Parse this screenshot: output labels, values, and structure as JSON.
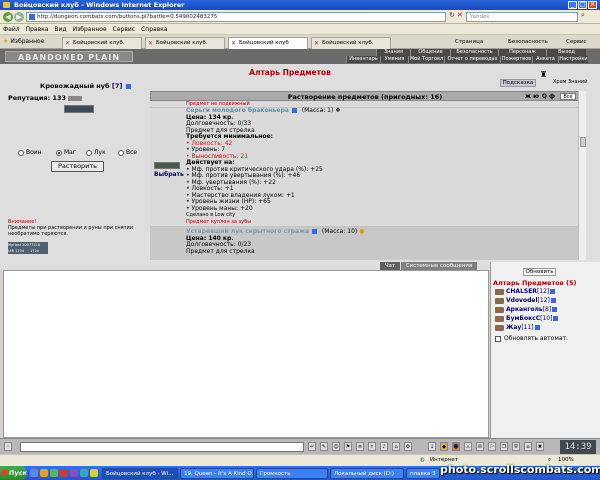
{
  "window": {
    "title": "Бойцовский клуб - Windows Internet Explorer",
    "url": "http://dungeon.combats.com/buttons.pl?battle=0.549002483275",
    "search_placeholder": "Yandex"
  },
  "menu": [
    "Файл",
    "Правка",
    "Вид",
    "Избранное",
    "Сервис",
    "Справка"
  ],
  "tabs_bar": {
    "favorites": "Избранное",
    "tabs": [
      "Бойцовский клуб.",
      "Бойцовский клуб.",
      "Бойцовский клуб",
      "Бойцовский клуб."
    ],
    "tools": [
      "Страница",
      "Безопасность",
      "Сервис"
    ]
  },
  "game": {
    "logo": "ABANDONED PLAIN",
    "nav_top": [
      "Знания",
      "Общение",
      "Безопасность",
      "Персонаж",
      "Выход"
    ],
    "nav_bottom": [
      "Инвентарь",
      "Умения",
      "Мой Торговл",
      "Отчет о переводах",
      "Пожертвов",
      "Анкета",
      "Настройки"
    ],
    "guard_label": "Храм Знаний",
    "page_title": "Алтарь Предметов",
    "hint_button": "Подсказка",
    "user": {
      "name": "Кровожадный нуб",
      "level": "[7]"
    },
    "reputation": "Репутация: 133",
    "classes": [
      {
        "label": "Воин",
        "selected": false
      },
      {
        "label": "Маг",
        "selected": true
      },
      {
        "label": "Лук",
        "selected": false
      },
      {
        "label": "Все",
        "selected": false
      }
    ],
    "dissolve_button": "Растворить",
    "warning_title": "Внимание!",
    "warning_text": "Предметы при растворении и руны при снятии необратимо теряются.",
    "counters": [
      "MyHost 20077118",
      "UIR 1234",
      "1724"
    ],
    "table_header": "Растворение предметов (пригодных: 16)",
    "table_controls": [
      "ж",
      "ю",
      "Q",
      "ф"
    ],
    "filter_select": "Все",
    "choose_label": "Выбрать",
    "items": [
      {
        "note_above": "Предмет не подвижный",
        "name": "Серьги молодого браконьера",
        "mass": "(Масса: 1)",
        "price": "Цена: 134 кр.",
        "durability": "Долговечность: 0/33",
        "item_for": "Предмет для стрелка",
        "req_title": "Требуется минимальное:",
        "reqs": [
          {
            "text": "• Ловкость: 42",
            "color": "#d01010"
          },
          {
            "text": "• Уровень: 7",
            "color": "#000000"
          },
          {
            "text": "• Выносливость: 21",
            "color": "#d01010"
          }
        ],
        "effects_title": "Действует на:",
        "effects": [
          "• Мф. против критического удара (%): +25",
          "• Мф. против увертывания (%): +46",
          "• Мф. увертывания (%): +22",
          "• Ловкость: +1",
          "• Мастерство владения луком: +1",
          "• Уровень жизни (HP): +65",
          "• Уровень маны: +20"
        ],
        "made_in": "Сделано в Low city",
        "bought_note": "Предмет куплен за зубы"
      },
      {
        "name": "Устаревший лук скрытного стража",
        "mass": "(Масса: 10)",
        "price": "Цена: 140 кр.",
        "durability": "Долговечность: 0/23",
        "item_for": "Предмет для стрелка"
      }
    ],
    "chat_tabs": [
      "Чат",
      "Системные сообщения"
    ],
    "refresh_button": "Обновить",
    "online_title": "Алтарь Предметов (5)",
    "online_users": [
      {
        "name": "CHALSER",
        "level": "[12]"
      },
      {
        "name": "Vdovodel",
        "level": "[12]"
      },
      {
        "name": "Арканголь",
        "level": "[8]"
      },
      {
        "name": "БумБоксС",
        "level": "[10]"
      },
      {
        "name": "Жау",
        "level": "[11]"
      }
    ],
    "auto_refresh": "Обновлять автомат.",
    "clock": "14:39"
  },
  "status": {
    "zone": "Интернет",
    "zoom": "100%"
  },
  "taskbar": {
    "start": "Пуск",
    "tasks": [
      "Бойцовский клуб - Wi...",
      "19. Queen - It's A Kind O...",
      "Громкость",
      "Локальный диск (D:)",
      "плавка 3"
    ]
  },
  "watermark": "photo.scrollscombats.com"
}
